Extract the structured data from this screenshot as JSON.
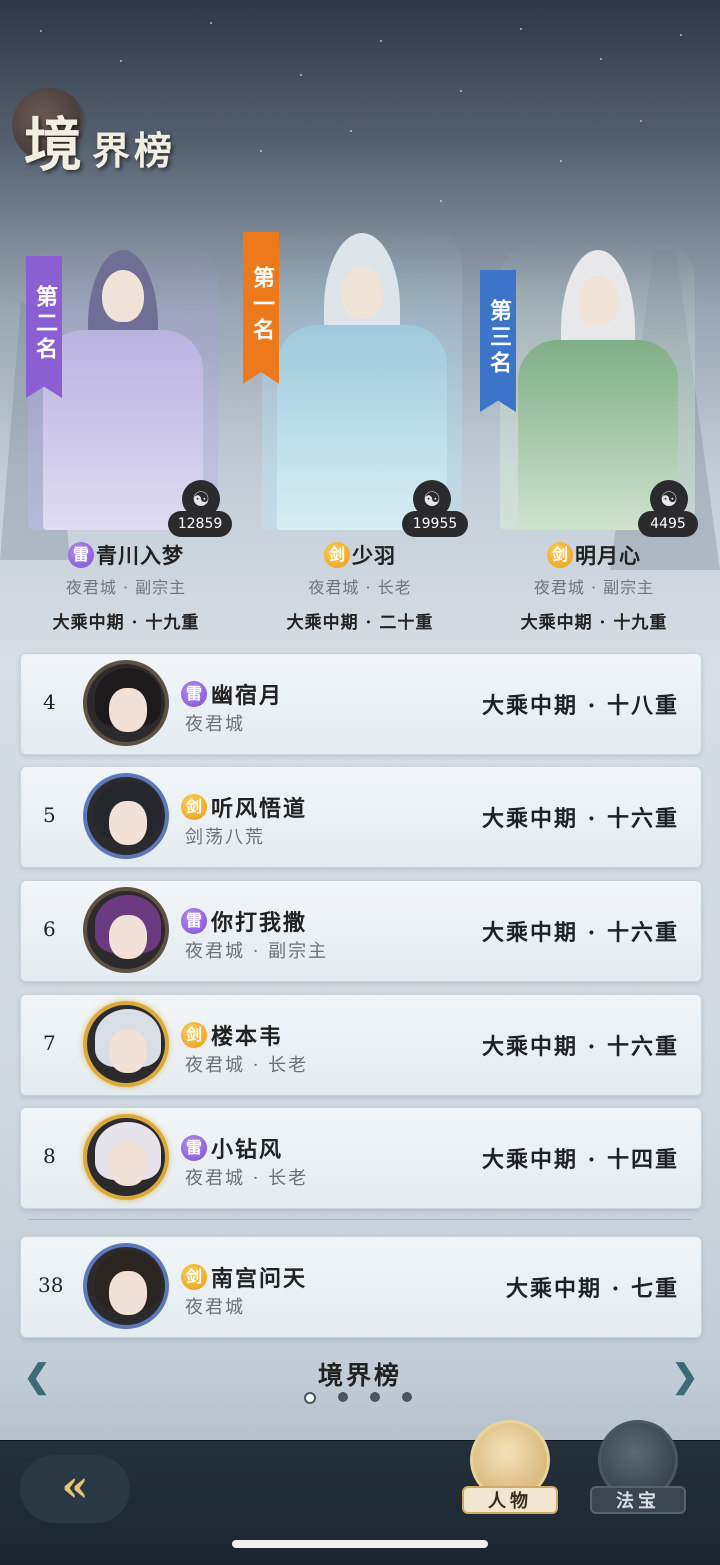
{
  "header": {
    "title_big": "境",
    "title_small": "界榜"
  },
  "podium": [
    {
      "rank_label": "第二名",
      "score": "12859",
      "element": "雷",
      "element_type": "lei",
      "name": "青川入梦",
      "sect": "夜君城 · 副宗主",
      "level": "大乘中期 · 十九重",
      "banner_color": "#8a5fd1"
    },
    {
      "rank_label": "第一名",
      "score": "19955",
      "element": "剑",
      "element_type": "jian",
      "name": "少羽",
      "sect": "夜君城 · 长老",
      "level": "大乘中期 · 二十重",
      "banner_color": "#ec7a1c"
    },
    {
      "rank_label": "第三名",
      "score": "4495",
      "element": "剑",
      "element_type": "jian",
      "name": "明月心",
      "sect": "夜君城 · 副宗主",
      "level": "大乘中期 · 十九重",
      "banner_color": "#3b74c9"
    }
  ],
  "rows": [
    {
      "rank": "4",
      "element": "雷",
      "element_type": "lei",
      "name": "幽宿月",
      "sect": "夜君城",
      "level": "大乘中期 · 十八重"
    },
    {
      "rank": "5",
      "element": "剑",
      "element_type": "jian",
      "name": "听风悟道",
      "sect": "剑荡八荒",
      "level": "大乘中期 · 十六重"
    },
    {
      "rank": "6",
      "element": "雷",
      "element_type": "lei",
      "name": "你打我撒",
      "sect": "夜君城 · 副宗主",
      "level": "大乘中期 · 十六重"
    },
    {
      "rank": "7",
      "element": "剑",
      "element_type": "jian",
      "name": "楼本韦",
      "sect": "夜君城 · 长老",
      "level": "大乘中期 · 十六重"
    },
    {
      "rank": "8",
      "element": "雷",
      "element_type": "lei",
      "name": "小钻风",
      "sect": "夜君城 · 长老",
      "level": "大乘中期 · 十四重"
    }
  ],
  "self_row": {
    "rank": "38",
    "element": "剑",
    "element_type": "jian",
    "name": "南宫问天",
    "sect": "夜君城",
    "level": "大乘中期 · 七重"
  },
  "footer": {
    "title": "境界榜",
    "page_index": 1,
    "page_count": 4,
    "prev_icon": "chevron-left-icon",
    "next_icon": "chevron-right-icon"
  },
  "bottom_nav": {
    "tab_character": "人物",
    "tab_treasure": "法宝",
    "back_icon": "back-arrow-icon"
  },
  "colors": {
    "lei": "#8a5fd1",
    "jian": "#ec9a1c",
    "gold_frame": "#d9a93c"
  }
}
